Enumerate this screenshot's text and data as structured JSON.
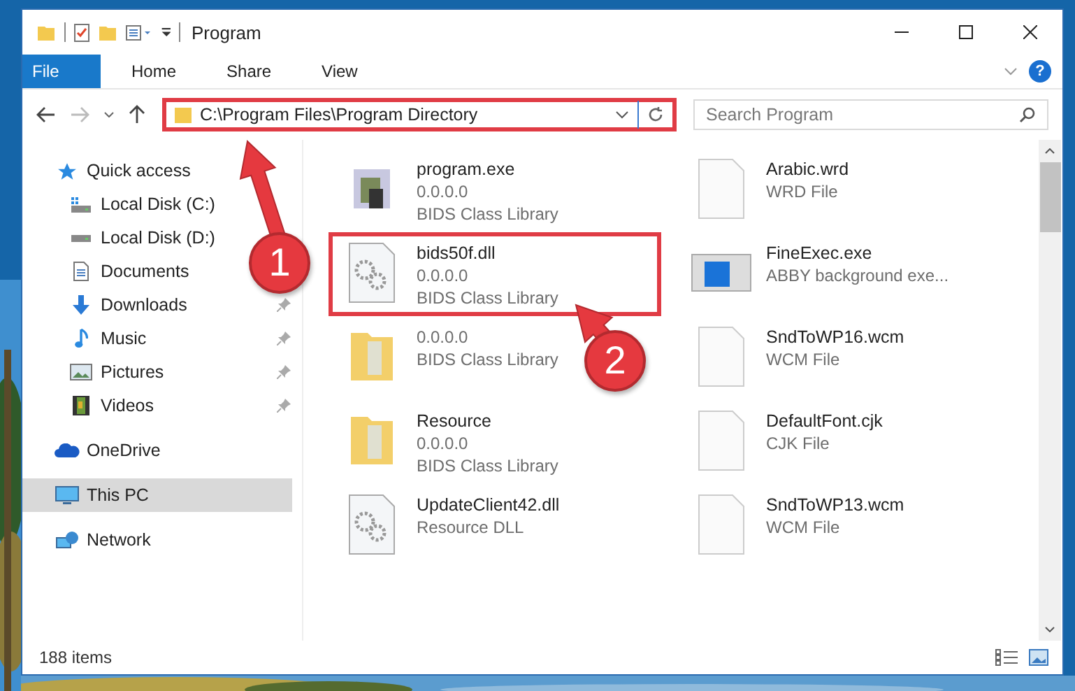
{
  "window": {
    "title": "Program"
  },
  "ribbon": {
    "tabs": [
      {
        "label": "File",
        "kind": "file",
        "selected": false
      },
      {
        "label": "Home",
        "kind": "tab",
        "selected": false
      },
      {
        "label": "Share",
        "kind": "tab",
        "selected": false
      },
      {
        "label": "View",
        "kind": "tab",
        "selected": false
      }
    ],
    "help": "?"
  },
  "address": {
    "path": "C:\\Program Files\\Program Directory",
    "highlighted": true
  },
  "search": {
    "placeholder": "Search Program"
  },
  "nav": [
    {
      "label": "Quick access",
      "kind": "star",
      "pinned": false,
      "selected": false,
      "children": [
        {
          "label": "Local Disk (C:)",
          "kind": "drive-windows",
          "pinned": false,
          "selected": false
        },
        {
          "label": "Local Disk (D:)",
          "kind": "drive",
          "pinned": false,
          "selected": false
        },
        {
          "label": "Documents",
          "kind": "document",
          "pinned": false,
          "selected": false
        },
        {
          "label": "Downloads",
          "kind": "download",
          "pinned": true,
          "selected": false
        },
        {
          "label": "Music",
          "kind": "music",
          "pinned": true,
          "selected": false
        },
        {
          "label": "Pictures",
          "kind": "pictures",
          "pinned": true,
          "selected": false
        },
        {
          "label": "Videos",
          "kind": "videos",
          "pinned": true,
          "selected": false
        }
      ]
    },
    {
      "label": "OneDrive",
      "kind": "cloud",
      "pinned": false,
      "selected": false
    },
    {
      "label": "This PC",
      "kind": "pc",
      "pinned": false,
      "selected": true
    },
    {
      "label": "Network",
      "kind": "network",
      "pinned": false,
      "selected": false
    }
  ],
  "files": [
    {
      "name": "program.exe",
      "lines": [
        "0.0.0.0",
        "BIDS Class Library"
      ],
      "kind": "app",
      "highlighted": false
    },
    {
      "name": "Arabic.wrd",
      "lines": [
        "WRD File"
      ],
      "kind": "page",
      "highlighted": false
    },
    {
      "name": "bids50f.dll",
      "lines": [
        "0.0.0.0",
        "BIDS Class Library"
      ],
      "kind": "gears",
      "highlighted": true
    },
    {
      "name": "FineExec.exe",
      "lines": [
        "ABBY background exe..."
      ],
      "kind": "window",
      "highlighted": false
    },
    {
      "lines": [
        "0.0.0.0",
        "BIDS Class Library"
      ],
      "kind": "folder",
      "highlighted": false
    },
    {
      "name": "SndToWP16.wcm",
      "lines": [
        "WCM File"
      ],
      "kind": "page",
      "highlighted": false
    },
    {
      "name": "Resource",
      "lines": [
        "0.0.0.0",
        "BIDS Class Library"
      ],
      "kind": "folder",
      "highlighted": false
    },
    {
      "name": "DefaultFont.cjk",
      "lines": [
        "CJK File"
      ],
      "kind": "page",
      "highlighted": false
    },
    {
      "name": "UpdateClient42.dll",
      "lines": [
        "Resource DLL"
      ],
      "kind": "gears",
      "highlighted": false
    },
    {
      "name": "SndToWP13.wcm",
      "lines": [
        "WCM File"
      ],
      "kind": "page",
      "highlighted": false
    }
  ],
  "annotations": [
    {
      "number": "1"
    },
    {
      "number": "2"
    }
  ],
  "status_bar": {
    "count": "188 items"
  }
}
